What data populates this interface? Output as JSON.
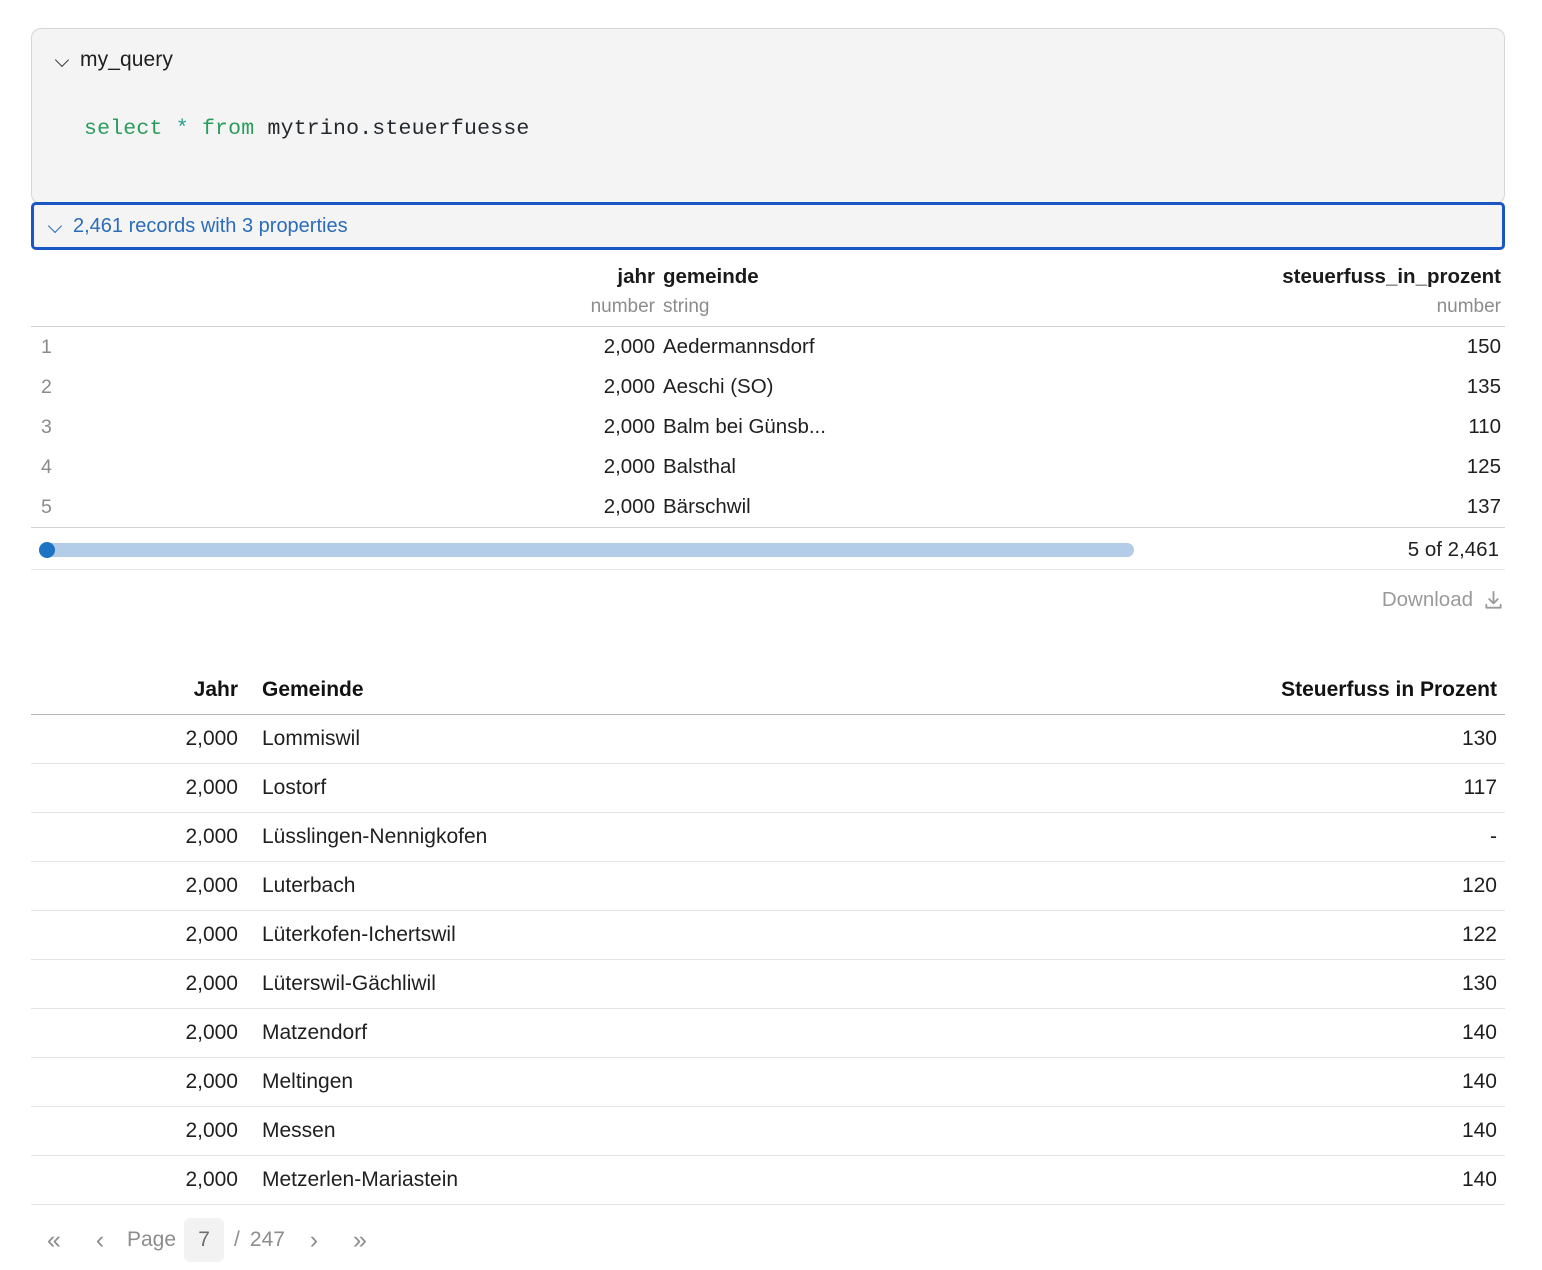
{
  "query_card": {
    "title": "my_query",
    "toggle_icon": "chevron-down-icon",
    "code_keyword_select": "select",
    "code_star": "*",
    "code_keyword_from": "from",
    "code_table": "mytrino.steuerfuesse"
  },
  "records_banner": {
    "toggle_icon": "chevron-down-icon",
    "label": "2,461 records with 3 properties",
    "accent_color": "#1a56c4",
    "text_color": "#2b6cb8"
  },
  "preview_table": {
    "columns": [
      {
        "name": "",
        "type": ""
      },
      {
        "name": "jahr",
        "type": "number"
      },
      {
        "name": "gemeinde",
        "type": "string"
      },
      {
        "name": "steuerfuss_in_prozent",
        "type": "number"
      }
    ],
    "rows": [
      {
        "idx": "1",
        "jahr": "2,000",
        "gemeinde": "Aedermannsdorf",
        "steuerfuss": "150"
      },
      {
        "idx": "2",
        "jahr": "2,000",
        "gemeinde": "Aeschi (SO)",
        "steuerfuss": "135"
      },
      {
        "idx": "3",
        "jahr": "2,000",
        "gemeinde": "Balm bei Günsb...",
        "steuerfuss": "110"
      },
      {
        "idx": "4",
        "jahr": "2,000",
        "gemeinde": "Balsthal",
        "steuerfuss": "125"
      },
      {
        "idx": "5",
        "jahr": "2,000",
        "gemeinde": "Bärschwil",
        "steuerfuss": "137"
      }
    ],
    "slider": {
      "count_label": "5 of 2,461",
      "value": 5,
      "max": 2461,
      "thumb_color": "#1e74c4",
      "track_color": "#b3cce8"
    },
    "download_label": "Download",
    "download_icon": "download-icon"
  },
  "main_table": {
    "headers": [
      "Jahr",
      "Gemeinde",
      "Steuerfuss in Prozent"
    ],
    "rows": [
      {
        "jahr": "2,000",
        "gemeinde": "Lommiswil",
        "steuerfuss": "130"
      },
      {
        "jahr": "2,000",
        "gemeinde": "Lostorf",
        "steuerfuss": "117"
      },
      {
        "jahr": "2,000",
        "gemeinde": "Lüsslingen-Nennigkofen",
        "steuerfuss": "-"
      },
      {
        "jahr": "2,000",
        "gemeinde": "Luterbach",
        "steuerfuss": "120"
      },
      {
        "jahr": "2,000",
        "gemeinde": "Lüterkofen-Ichertswil",
        "steuerfuss": "122"
      },
      {
        "jahr": "2,000",
        "gemeinde": "Lüterswil-Gächliwil",
        "steuerfuss": "130"
      },
      {
        "jahr": "2,000",
        "gemeinde": "Matzendorf",
        "steuerfuss": "140"
      },
      {
        "jahr": "2,000",
        "gemeinde": "Meltingen",
        "steuerfuss": "140"
      },
      {
        "jahr": "2,000",
        "gemeinde": "Messen",
        "steuerfuss": "140"
      },
      {
        "jahr": "2,000",
        "gemeinde": "Metzerlen-Mariastein",
        "steuerfuss": "140"
      }
    ]
  },
  "pagination": {
    "first_icon": "«",
    "prev_icon": "‹",
    "page_label": "Page",
    "current_page": "7",
    "separator": "/",
    "total_pages": "247",
    "next_icon": "›",
    "last_icon": "»"
  }
}
